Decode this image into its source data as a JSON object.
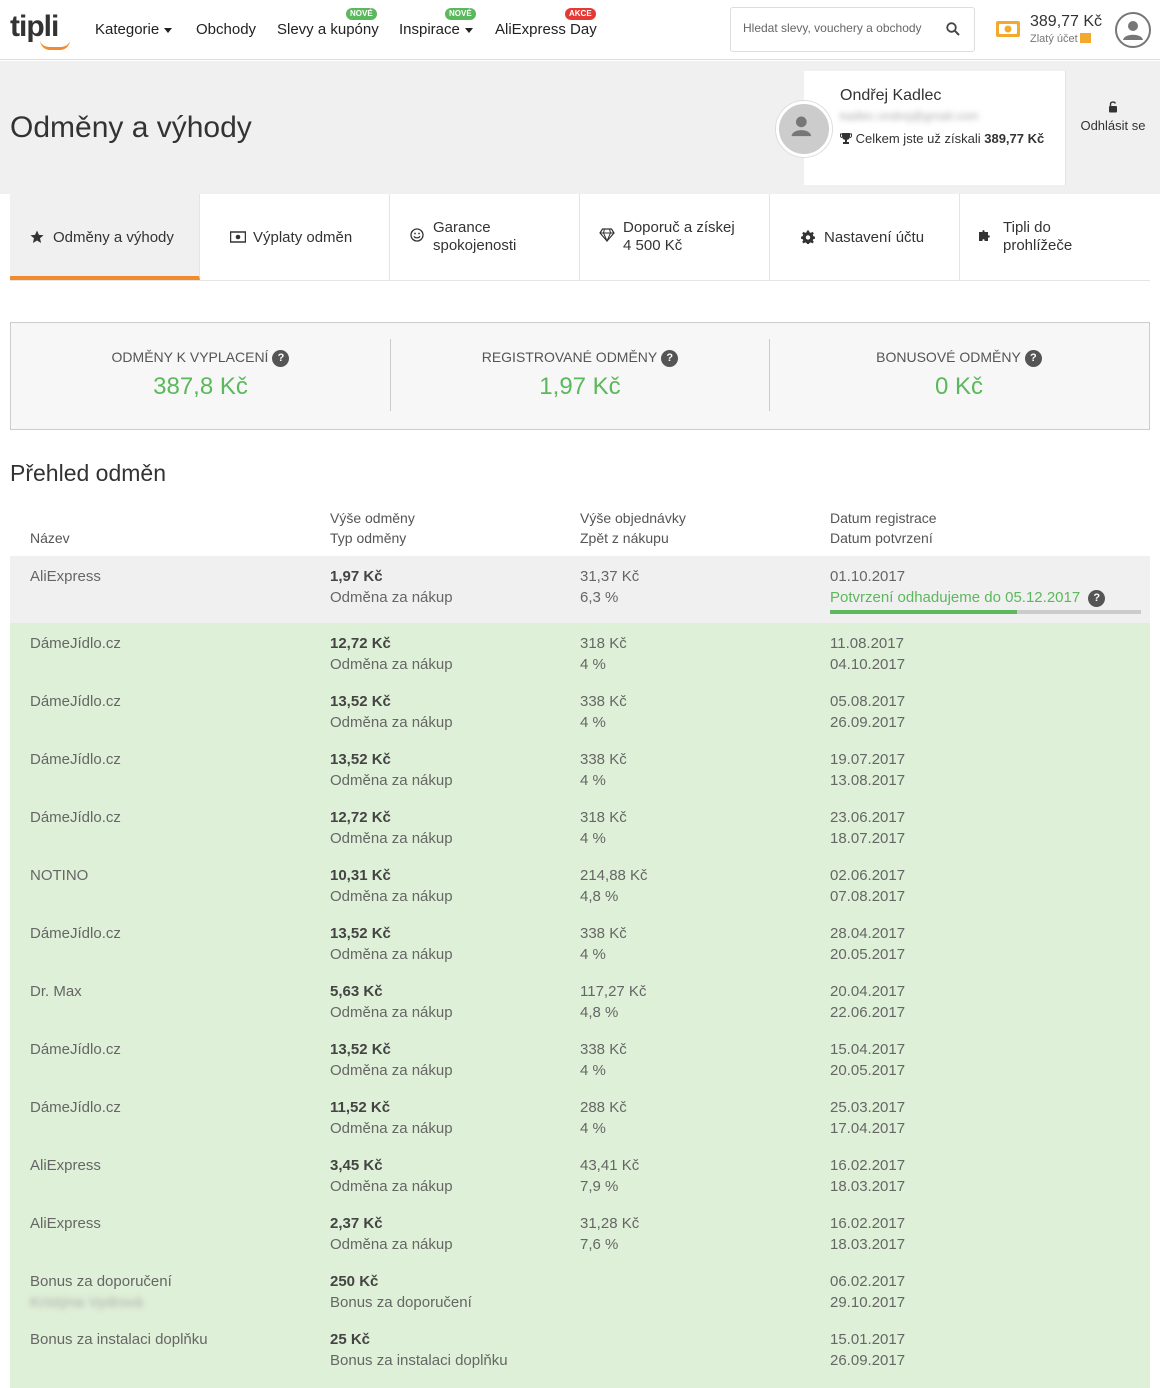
{
  "header": {
    "logo": "tipli",
    "nav": [
      {
        "label": "Kategorie",
        "dropdown": true
      },
      {
        "label": "Obchody",
        "dropdown": false
      },
      {
        "label": "Slevy a kupóny",
        "badge": "NOVÉ",
        "badge_color": "#5cb85c"
      },
      {
        "label": "Inspirace",
        "dropdown": true,
        "badge": "NOVÉ",
        "badge_color": "#5cb85c"
      },
      {
        "label": "AliExpress Day",
        "badge": "AKCE",
        "badge_color": "#e53935"
      }
    ],
    "search_placeholder": "Hledat slevy, vouchery a obchody",
    "balance": "389,77 Kč",
    "account_level": "Zlatý účet"
  },
  "profile": {
    "page_title": "Odměny a výhody",
    "name": "Ondřej Kadlec",
    "email": "kadlec.ondrej@gmail.com",
    "total_label": "Celkem jste už získali",
    "total_value": "389,77 Kč",
    "logout": "Odhlásit se"
  },
  "tabs": [
    {
      "label": "Odměny a výhody",
      "icon": "star-icon",
      "active": true
    },
    {
      "label": "Výplaty odměn",
      "icon": "banknote-icon"
    },
    {
      "label_l1": "Garance",
      "label_l2": "spokojenosti",
      "icon": "smile-icon"
    },
    {
      "label_l1": "Doporuč a získej",
      "label_l2": "4 500 Kč",
      "icon": "diamond-icon"
    },
    {
      "label": "Nastavení účtu",
      "icon": "gear-icon"
    },
    {
      "label_l1": "Tipli do",
      "label_l2": "prohlížeče",
      "icon": "puzzle-icon"
    }
  ],
  "stats": [
    {
      "label": "Odměny k vyplacení",
      "value": "387,8 Kč"
    },
    {
      "label": "Registrované odměny",
      "value": "1,97 Kč"
    },
    {
      "label": "Bonusové odměny",
      "value": "0 Kč"
    }
  ],
  "overview": {
    "title": "Přehled odměn",
    "columns": {
      "name": "Název",
      "reward_l1": "Výše odměny",
      "reward_l2": "Typ odměny",
      "order_l1": "Výše objednávky",
      "order_l2": "Zpět z nákupu",
      "date_l1": "Datum registrace",
      "date_l2": "Datum potvrzení"
    },
    "pending": {
      "name": "AliExpress",
      "reward": "1,97 Kč",
      "type": "Odměna za nákup",
      "order": "31,37 Kč",
      "percent": "6,3 %",
      "registered": "01.10.2017",
      "estimate": "Potvrzení odhadujeme do 05.12.2017",
      "progress": 0.6
    },
    "rows": [
      {
        "name": "DámeJídlo.cz",
        "reward": "12,72 Kč",
        "type": "Odměna za nákup",
        "order": "318 Kč",
        "percent": "4 %",
        "registered": "11.08.2017",
        "confirmed": "04.10.2017"
      },
      {
        "name": "DámeJídlo.cz",
        "reward": "13,52 Kč",
        "type": "Odměna za nákup",
        "order": "338 Kč",
        "percent": "4 %",
        "registered": "05.08.2017",
        "confirmed": "26.09.2017"
      },
      {
        "name": "DámeJídlo.cz",
        "reward": "13,52 Kč",
        "type": "Odměna za nákup",
        "order": "338 Kč",
        "percent": "4 %",
        "registered": "19.07.2017",
        "confirmed": "13.08.2017"
      },
      {
        "name": "DámeJídlo.cz",
        "reward": "12,72 Kč",
        "type": "Odměna za nákup",
        "order": "318 Kč",
        "percent": "4 %",
        "registered": "23.06.2017",
        "confirmed": "18.07.2017"
      },
      {
        "name": "NOTINO",
        "reward": "10,31 Kč",
        "type": "Odměna za nákup",
        "order": "214,88 Kč",
        "percent": "4,8 %",
        "registered": "02.06.2017",
        "confirmed": "07.08.2017"
      },
      {
        "name": "DámeJídlo.cz",
        "reward": "13,52 Kč",
        "type": "Odměna za nákup",
        "order": "338 Kč",
        "percent": "4 %",
        "registered": "28.04.2017",
        "confirmed": "20.05.2017"
      },
      {
        "name": "Dr. Max",
        "reward": "5,63 Kč",
        "type": "Odměna za nákup",
        "order": "117,27 Kč",
        "percent": "4,8 %",
        "registered": "20.04.2017",
        "confirmed": "22.06.2017"
      },
      {
        "name": "DámeJídlo.cz",
        "reward": "13,52 Kč",
        "type": "Odměna za nákup",
        "order": "338 Kč",
        "percent": "4 %",
        "registered": "15.04.2017",
        "confirmed": "20.05.2017"
      },
      {
        "name": "DámeJídlo.cz",
        "reward": "11,52 Kč",
        "type": "Odměna za nákup",
        "order": "288 Kč",
        "percent": "4 %",
        "registered": "25.03.2017",
        "confirmed": "17.04.2017"
      },
      {
        "name": "AliExpress",
        "reward": "3,45 Kč",
        "type": "Odměna za nákup",
        "order": "43,41 Kč",
        "percent": "7,9 %",
        "registered": "16.02.2017",
        "confirmed": "18.03.2017"
      },
      {
        "name": "AliExpress",
        "reward": "2,37 Kč",
        "type": "Odměna za nákup",
        "order": "31,28 Kč",
        "percent": "7,6 %",
        "registered": "16.02.2017",
        "confirmed": "18.03.2017"
      },
      {
        "name": "Bonus za doporučení",
        "subname": "Kristýna Vydrová",
        "reward": "250 Kč",
        "type": "Bonus za doporučení",
        "order": "",
        "percent": "",
        "registered": "06.02.2017",
        "confirmed": "29.10.2017"
      },
      {
        "name": "Bonus za instalaci doplňku",
        "reward": "25 Kč",
        "type": "Bonus za instalaci doplňku",
        "order": "",
        "percent": "",
        "registered": "15.01.2017",
        "confirmed": "26.09.2017"
      }
    ]
  }
}
